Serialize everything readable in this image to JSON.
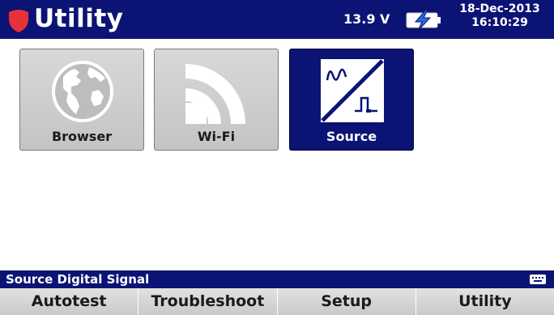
{
  "header": {
    "title": "Utility",
    "logo_icon": "shield-logo",
    "voltage": "13.9 V",
    "battery_icon": "battery-charging-icon",
    "date": "18-Dec-2013",
    "time": "16:10:29"
  },
  "tiles": [
    {
      "label": "Browser",
      "icon": "globe-icon",
      "selected": false
    },
    {
      "label": "Wi-Fi",
      "icon": "wifi-icon",
      "selected": false
    },
    {
      "label": "Source",
      "icon": "source-signal-icon",
      "selected": true
    }
  ],
  "status": {
    "text": "Source Digital Signal",
    "icon": "keyboard-icon"
  },
  "softkeys": [
    "Autotest",
    "Troubleshoot",
    "Setup",
    "Utility"
  ],
  "colors": {
    "header_bg": "#0b1474",
    "logo_red": "#e8323a",
    "battery_bolt": "#2a6ad8",
    "tile_grey": "#cfcfcf"
  }
}
